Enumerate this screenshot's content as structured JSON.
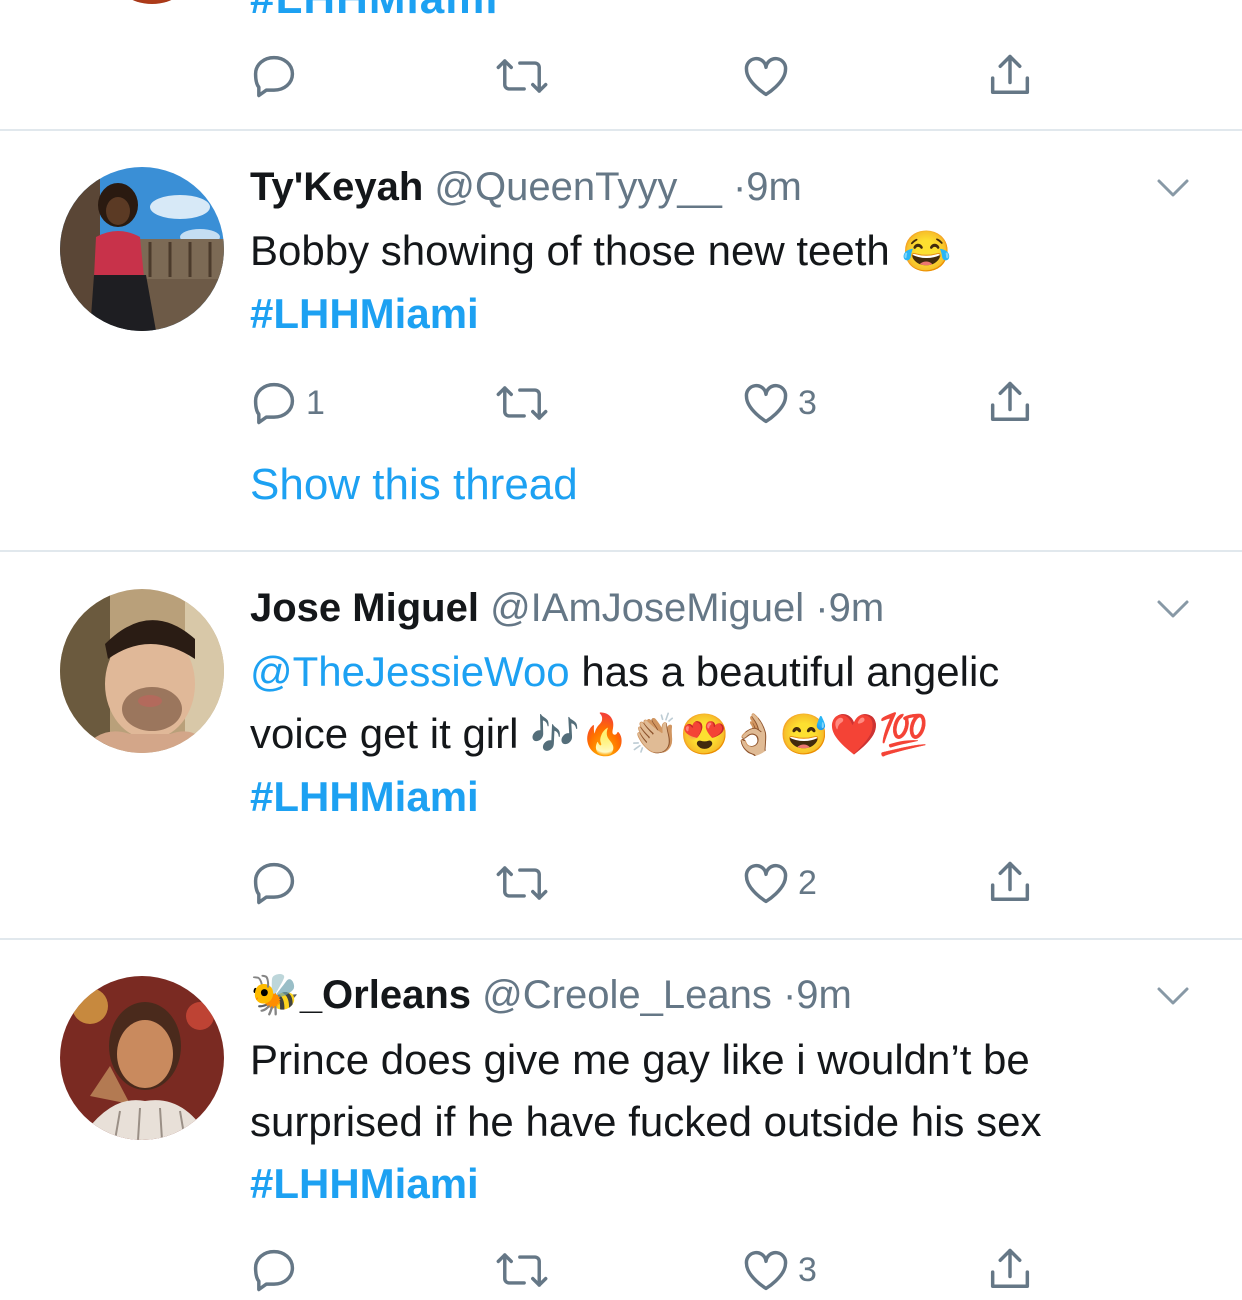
{
  "top_partial": {
    "hashtag": "#LHHMiami"
  },
  "tweets": [
    {
      "name": "Ty'Keyah",
      "handle": "@QueenTyyy__",
      "time": "9m",
      "text": "Bobby showing of those new teeth",
      "emojis": "😂",
      "hashtag": "#LHHMiami",
      "replies": "1",
      "retweets": "",
      "likes": "3",
      "show_thread": "Show this thread"
    },
    {
      "name": "Jose Miguel",
      "handle": "@IAmJoseMiguel",
      "time": "9m",
      "mention": "@TheJessieWoo",
      "text_line1": " has a beautiful angelic",
      "text_line2": "voice get it girl",
      "emojis": "🎶🔥👏🏼😍👌🏼😅❤️💯",
      "hashtag": "#LHHMiami",
      "replies": "",
      "retweets": "",
      "likes": "2"
    },
    {
      "name_emoji": "🐝",
      "name": "_Orleans",
      "handle": "@Creole_Leans",
      "time": "9m",
      "text_line1": "Prince does give me gay like i wouldn’t be",
      "text_line2": "surprised if he have fucked outside his sex",
      "hashtag": "#LHHMiami",
      "likes": "3"
    }
  ],
  "separator": "·",
  "colors": {
    "link": "#1da1f2",
    "secondary": "#657786",
    "divider": "#e1e8ed"
  }
}
